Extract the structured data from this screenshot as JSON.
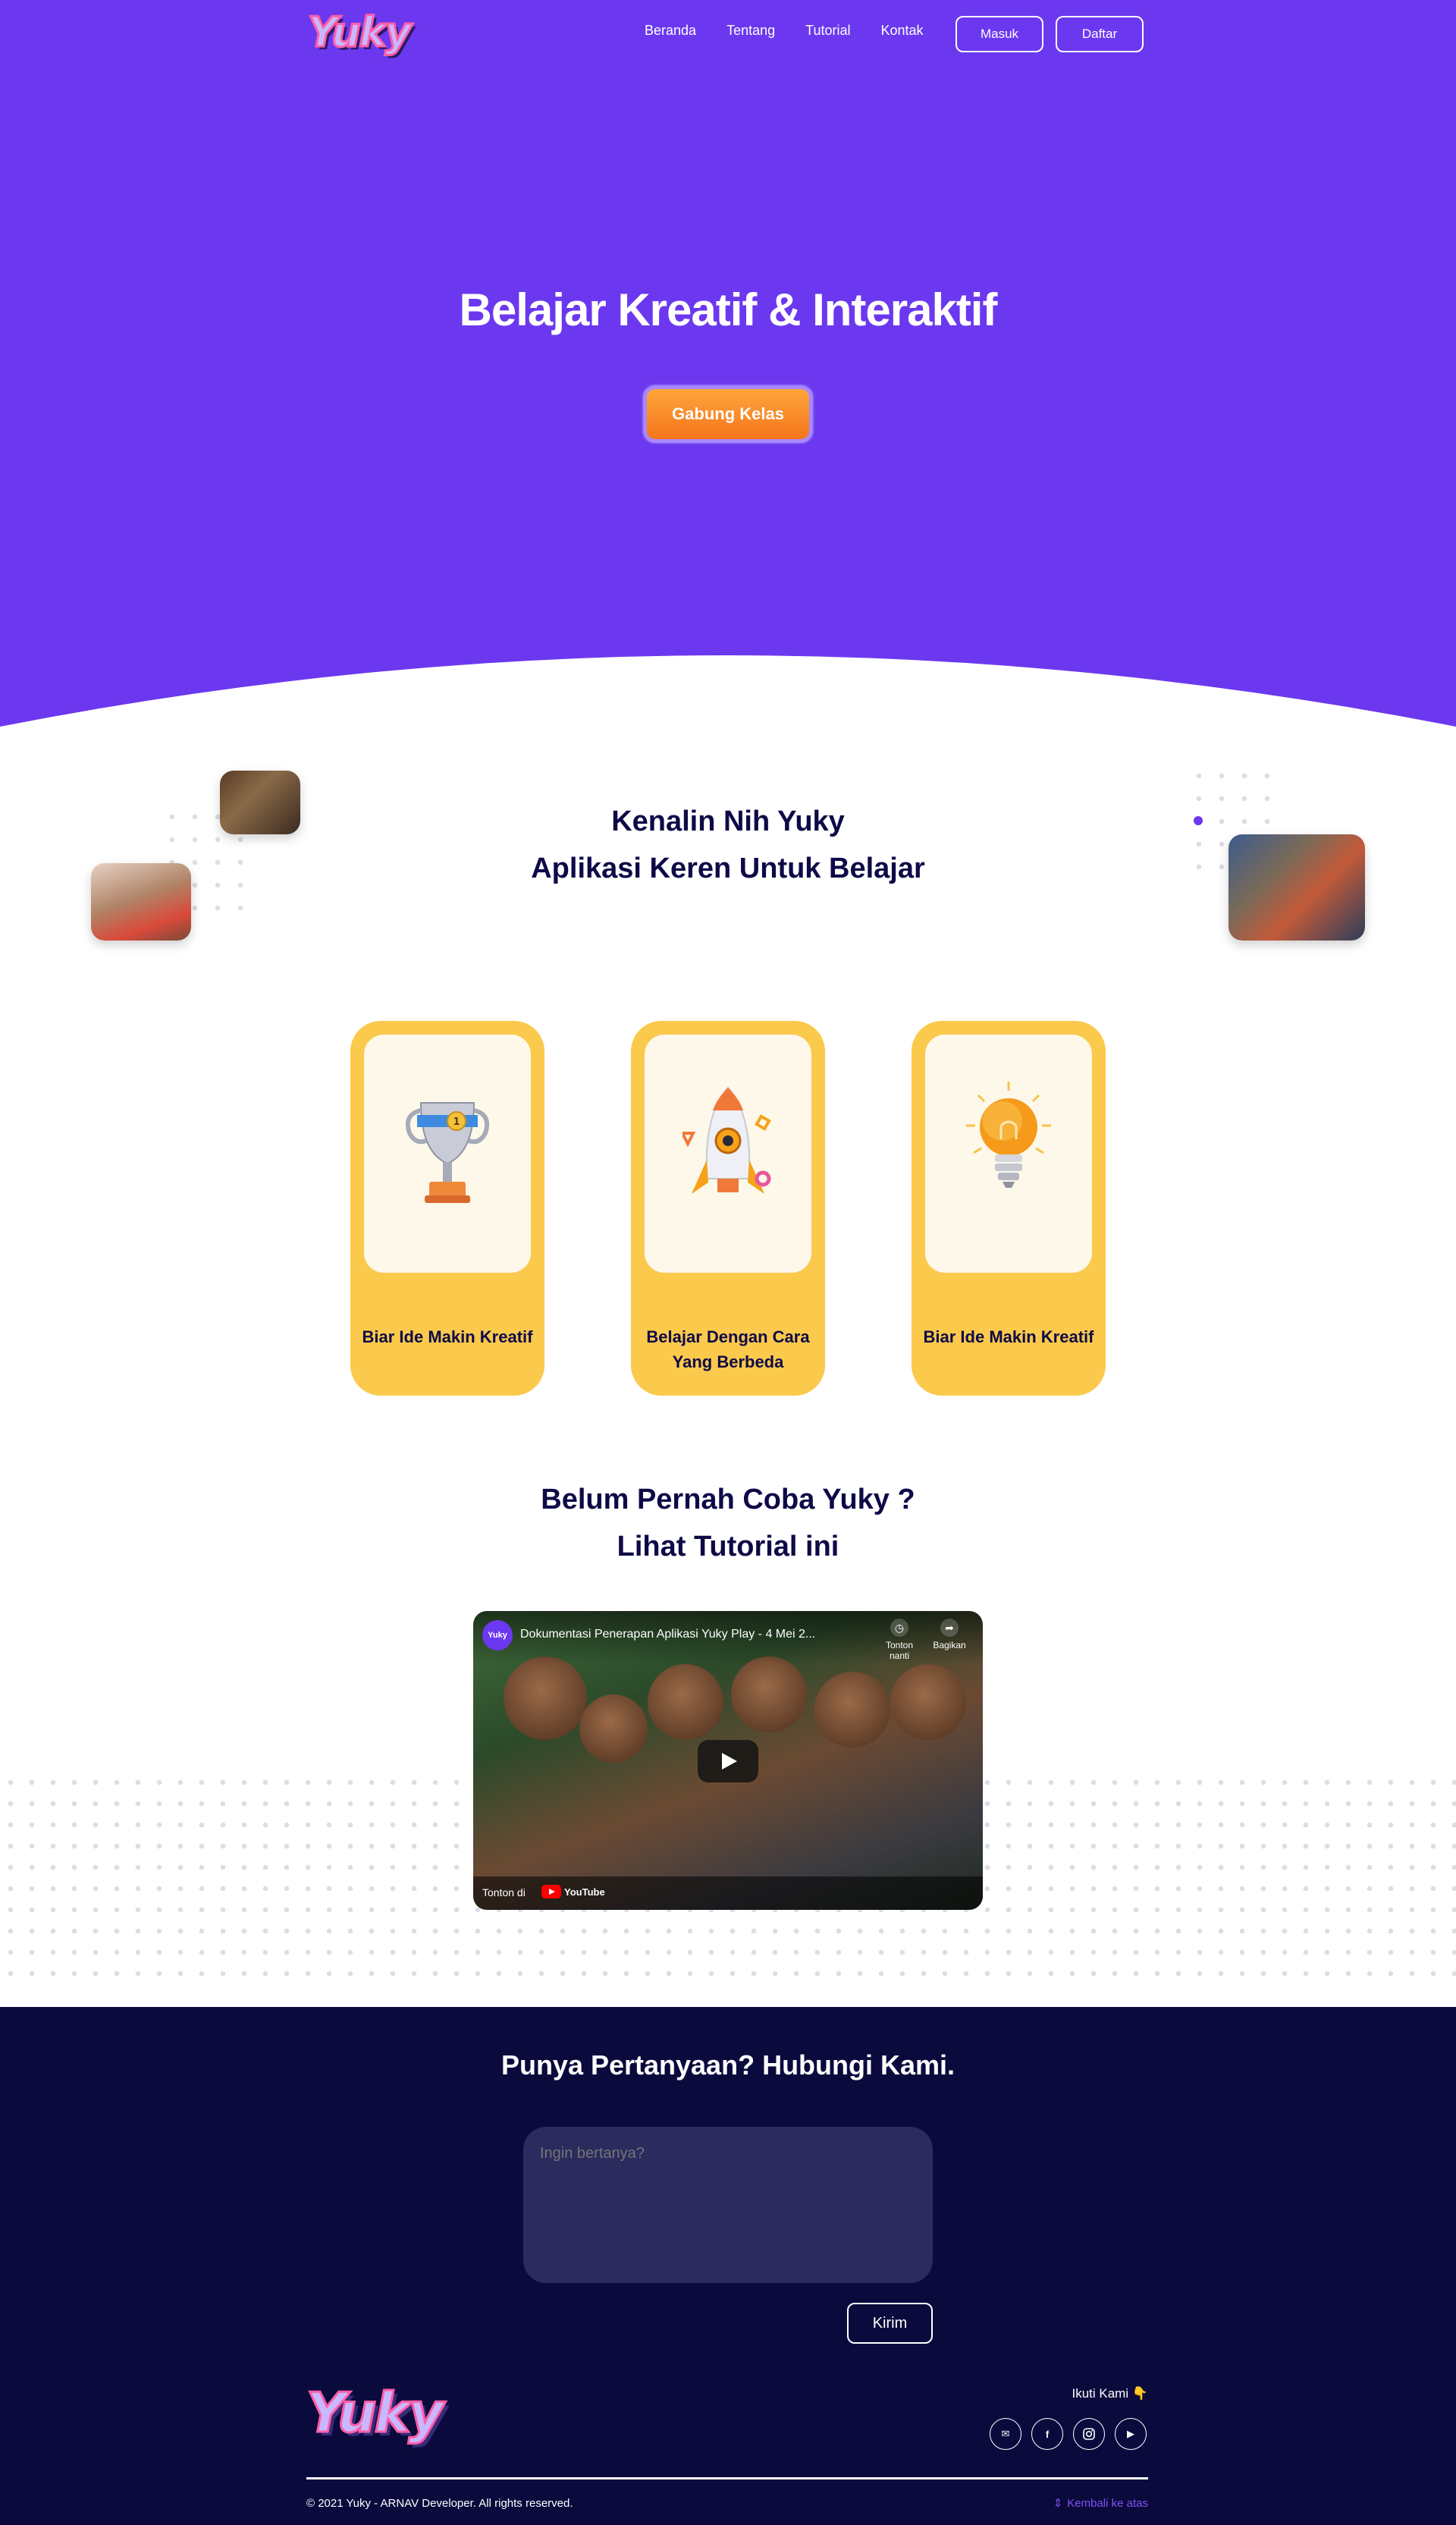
{
  "nav": {
    "logo": "Yuky",
    "links": [
      "Beranda",
      "Tentang",
      "Tutorial",
      "Kontak"
    ],
    "login_label": "Masuk",
    "register_label": "Daftar"
  },
  "hero": {
    "title": "Belajar Kreatif & Interaktif",
    "cta_label": "Gabung Kelas"
  },
  "about": {
    "title_line1": "Kenalin Nih Yuky",
    "title_line2": "Aplikasi Keren Untuk Belajar"
  },
  "features": [
    {
      "icon": "trophy-icon",
      "label": "Biar Ide Makin Kreatif"
    },
    {
      "icon": "rocket-icon",
      "label": "Belajar Dengan Cara Yang Berbeda"
    },
    {
      "icon": "lightbulb-icon",
      "label": "Biar Ide Makin Kreatif"
    }
  ],
  "tutorial": {
    "title_line1": "Belum Pernah Coba Yuky ?",
    "title_line2": "Lihat Tutorial ini",
    "video_channel": "Yuky",
    "video_title": "Dokumentasi Penerapan Aplikasi Yuky Play - 4 Mei 2...",
    "watch_later_label": "Tonton nanti",
    "share_label": "Bagikan",
    "watch_on_label": "Tonton di",
    "youtube_label": "YouTube"
  },
  "contact": {
    "title": "Punya Pertanyaan? Hubungi Kami.",
    "question_placeholder": "Ingin bertanya?",
    "send_label": "Kirim"
  },
  "footer": {
    "logo": "Yuky",
    "follow_label": "Ikuti Kami 👇",
    "socials": [
      "mail-icon",
      "facebook-icon",
      "instagram-icon",
      "youtube-icon"
    ],
    "copyright": "© 2021 Yuky - ARNAV Developer. All rights reserved.",
    "back_to_top": "Kembali ke atas"
  },
  "colors": {
    "primary": "#6c38ef",
    "accent_orange": "#f5741b",
    "card_yellow": "#fbc94b",
    "footer_navy": "#0b0a3d",
    "heading_navy": "#0e0a47"
  }
}
